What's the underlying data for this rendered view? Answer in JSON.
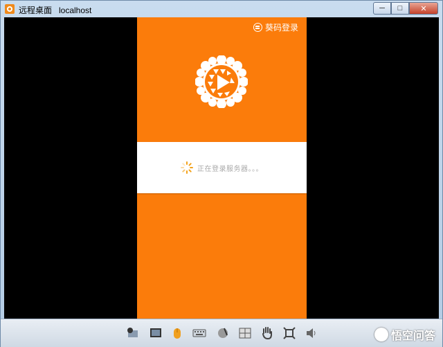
{
  "window": {
    "title": "远程桌面   localhost",
    "minimize_label": "─",
    "maximize_label": "□",
    "close_label": "✕"
  },
  "phone": {
    "qr_login_label": "葵码登录",
    "status_text": "正在登录服务器。。。",
    "brand_color": "#fb7c0b"
  },
  "toolbar": {
    "icons": [
      "badge-icon",
      "screen-icon",
      "mouse-icon",
      "keyboard-icon",
      "brush-icon",
      "grid-icon",
      "hand-icon",
      "fullscreen-icon",
      "speaker-icon"
    ]
  },
  "watermark": {
    "text": "悟空问答"
  }
}
